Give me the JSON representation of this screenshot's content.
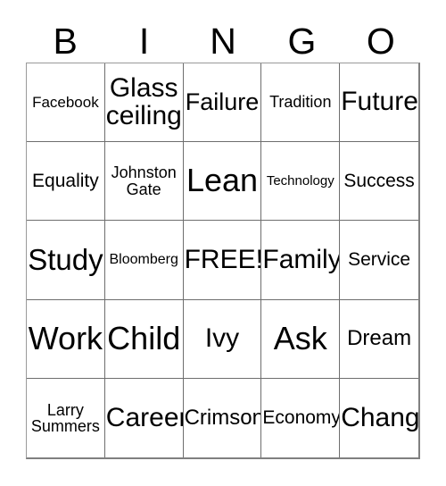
{
  "card": {
    "header_letters": [
      "B",
      "I",
      "N",
      "G",
      "O"
    ],
    "columns": 5,
    "rows": 5,
    "free_space_label": "FREE!",
    "free_space_position": "row3-col3",
    "colors": {
      "background": "#ffffff",
      "text": "#000000",
      "grid_line": "#6e6e6e",
      "outer_border": "#808080"
    },
    "cells": [
      {
        "text": "Facebook",
        "size": "fs-sm",
        "lines": 1
      },
      {
        "text": "Glass ceiling",
        "size": "fs-xxl",
        "lines": 2
      },
      {
        "text": "Failure",
        "size": "fs-xl",
        "lines": 1
      },
      {
        "text": "Tradition",
        "size": "fs-m",
        "lines": 1
      },
      {
        "text": "Future",
        "size": "fs-xxl",
        "lines": 1
      },
      {
        "text": "Equality",
        "size": "fs-ml",
        "lines": 1
      },
      {
        "text": "Johnston Gate",
        "size": "fs-m",
        "lines": 2
      },
      {
        "text": "Lean",
        "size": "fs-4xl",
        "lines": 1
      },
      {
        "text": "Technology",
        "size": "fs-xs",
        "lines": 1
      },
      {
        "text": "Success",
        "size": "fs-ml",
        "lines": 1
      },
      {
        "text": "Study",
        "size": "fs-3xl",
        "lines": 1
      },
      {
        "text": "Bloomberg",
        "size": "fs-s",
        "lines": 1
      },
      {
        "text": "FREE!",
        "size": "fs-xxl",
        "lines": 1
      },
      {
        "text": "Family",
        "size": "fs-xxl",
        "lines": 1
      },
      {
        "text": "Service",
        "size": "fs-ml",
        "lines": 1
      },
      {
        "text": "Work",
        "size": "fs-4xl",
        "lines": 1
      },
      {
        "text": "Child",
        "size": "fs-4xl",
        "lines": 1
      },
      {
        "text": "Ivy",
        "size": "fs-xxl",
        "lines": 1
      },
      {
        "text": "Ask",
        "size": "fs-4xl",
        "lines": 1
      },
      {
        "text": "Dream",
        "size": "fs-l",
        "lines": 1
      },
      {
        "text": "Larry Summers",
        "size": "fs-m",
        "lines": 2
      },
      {
        "text": "Career",
        "size": "fs-xxl",
        "lines": 1
      },
      {
        "text": "Crimson",
        "size": "fs-l",
        "lines": 1
      },
      {
        "text": "Economy",
        "size": "fs-ml",
        "lines": 1
      },
      {
        "text": "Change",
        "size": "fs-xxl",
        "lines": 1
      }
    ]
  }
}
